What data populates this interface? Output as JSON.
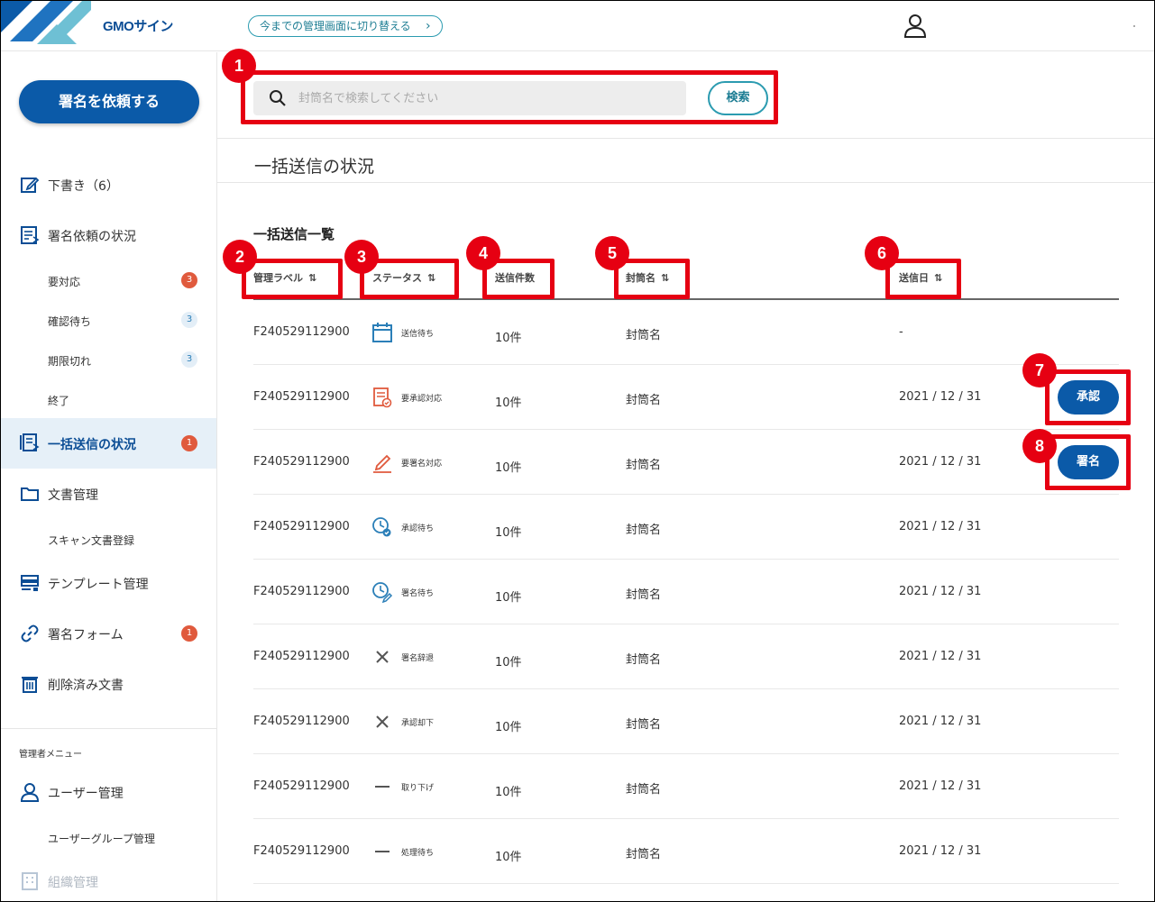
{
  "header": {
    "logo_text": "GMOサイン",
    "switch_label": "今までの管理画面に切り替える",
    "switch_chevron": "›"
  },
  "sidebar": {
    "request_button": "署名を依頼する",
    "items": [
      {
        "label": "下書き（6）",
        "icon": "edit-icon"
      },
      {
        "label": "署名依頼の状況",
        "icon": "document-list-icon"
      },
      {
        "label": "一括送信の状況",
        "icon": "bulk-send-icon",
        "badge": "1"
      },
      {
        "label": "文書管理",
        "icon": "folder-icon"
      },
      {
        "label": "テンプレート管理",
        "icon": "template-icon"
      },
      {
        "label": "署名フォーム",
        "icon": "link-icon",
        "badge": "1"
      },
      {
        "label": "削除済み文書",
        "icon": "trash-icon"
      }
    ],
    "subitems": [
      {
        "label": "要対応",
        "badge": "3"
      },
      {
        "label": "確認待ち",
        "badge": "3"
      },
      {
        "label": "期限切れ",
        "badge": "3"
      },
      {
        "label": "終了"
      },
      {
        "label": "スキャン文書登録"
      }
    ],
    "admin": {
      "title": "管理者メニュー",
      "user_mgmt": "ユーザー管理",
      "user_group": "ユーザーグループ管理",
      "org_mgmt": "組織管理"
    }
  },
  "search": {
    "placeholder": "封筒名で検索してください",
    "button": "検索"
  },
  "page": {
    "title": "一括送信の状況",
    "list_title": "一括送信一覧"
  },
  "table": {
    "headers": {
      "label": "管理ラベル",
      "status": "ステータス",
      "count": "送信件数",
      "envelope": "封筒名",
      "date": "送信日",
      "sort_glyph": "⇅"
    },
    "rows": [
      {
        "label": "F240529112900",
        "status": "送信待ち",
        "icon": "calendar-icon",
        "count": "10件",
        "envelope": "封筒名",
        "date": "-",
        "action": ""
      },
      {
        "label": "F240529112900",
        "status": "要承認対応",
        "icon": "approval-doc-icon",
        "count": "10件",
        "envelope": "封筒名",
        "date": "2021 / 12 / 31",
        "action": "承認"
      },
      {
        "label": "F240529112900",
        "status": "要署名対応",
        "icon": "pen-icon",
        "count": "10件",
        "envelope": "封筒名",
        "date": "2021 / 12 / 31",
        "action": "署名"
      },
      {
        "label": "F240529112900",
        "status": "承認待ち",
        "icon": "clock-check-icon",
        "count": "10件",
        "envelope": "封筒名",
        "date": "2021 / 12 / 31",
        "action": ""
      },
      {
        "label": "F240529112900",
        "status": "署名待ち",
        "icon": "clock-pen-icon",
        "count": "10件",
        "envelope": "封筒名",
        "date": "2021 / 12 / 31",
        "action": ""
      },
      {
        "label": "F240529112900",
        "status": "署名辞退",
        "icon": "x-icon",
        "count": "10件",
        "envelope": "封筒名",
        "date": "2021 / 12 / 31",
        "action": ""
      },
      {
        "label": "F240529112900",
        "status": "承認却下",
        "icon": "x-icon",
        "count": "10件",
        "envelope": "封筒名",
        "date": "2021 / 12 / 31",
        "action": ""
      },
      {
        "label": "F240529112900",
        "status": "取り下げ",
        "icon": "dash-icon",
        "count": "10件",
        "envelope": "封筒名",
        "date": "2021 / 12 / 31",
        "action": ""
      },
      {
        "label": "F240529112900",
        "status": "処理待ち",
        "icon": "dash-icon",
        "count": "10件",
        "envelope": "封筒名",
        "date": "2021 / 12 / 31",
        "action": ""
      }
    ]
  },
  "annotations": [
    "1",
    "2",
    "3",
    "4",
    "5",
    "6",
    "7",
    "8"
  ],
  "colors": {
    "brand": "#0b5aa8",
    "accent": "#2b9bb0",
    "annotation": "#e60012",
    "badge_red": "#e05a3d"
  }
}
